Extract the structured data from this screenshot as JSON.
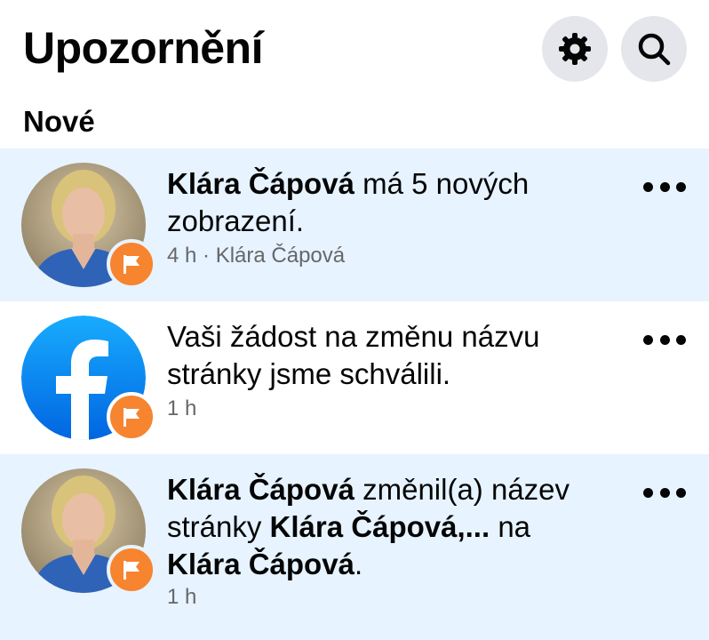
{
  "header": {
    "title": "Upozornění",
    "settings_icon": "gear-icon",
    "search_icon": "search-icon"
  },
  "section": {
    "label": "Nové"
  },
  "colors": {
    "unread_bg": "#e7f3ff",
    "badge": "#f7842f",
    "facebook_blue": "#1877f2",
    "muted_text": "#65676b"
  },
  "notifications": [
    {
      "unread": true,
      "avatar": "profile-photo",
      "badge_icon": "flag-icon",
      "name": "Klára Čápová",
      "text": " má 5 nových zobrazení.",
      "time": "4 h · Klára Čápová"
    },
    {
      "unread": false,
      "avatar": "facebook-logo",
      "badge_icon": "flag-icon",
      "text": "Vaši žádost na změnu názvu stránky jsme schválili.",
      "time": "1 h"
    },
    {
      "unread": true,
      "avatar": "profile-photo",
      "badge_icon": "flag-icon",
      "name": "Klára Čápová",
      "text_1": " změnil(a) název stránky ",
      "old_page_name": "Klára Čápová,...",
      "text_2": " na ",
      "new_page_name": "Klára Čápová",
      "text_3": ".",
      "time": "1 h"
    }
  ]
}
